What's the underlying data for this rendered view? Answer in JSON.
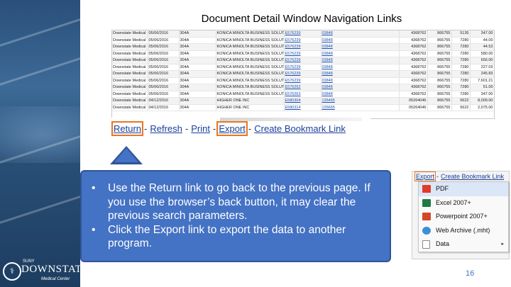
{
  "slide": {
    "title": "Document Detail Window Navigation Links",
    "page_number": "16"
  },
  "logo": {
    "suny": "SUNY",
    "brand": "DOWNSTATE",
    "sub": "Medical Center"
  },
  "table": {
    "rows": [
      [
        "Downstate Medical",
        "05/06/2016",
        "304A",
        "KONICA MINOLTA BUSINESS SOLUTI",
        "E576239",
        "03848",
        "4368762",
        "866755",
        "5135",
        "347.00"
      ],
      [
        "Downstate Medical",
        "05/06/2016",
        "304A",
        "KONICA MINOLTA BUSINESS SOLUTI",
        "E576239",
        "03848",
        "4368762",
        "866755",
        "7280",
        "44.00"
      ],
      [
        "Downstate Medical",
        "05/06/2016",
        "304A",
        "KONICA MINOLTA BUSINESS SOLUTI",
        "E576239",
        "03848",
        "4368762",
        "866755",
        "7280",
        "44.52"
      ],
      [
        "Downstate Medical",
        "05/06/2016",
        "304A",
        "KONICA MINOLTA BUSINESS SOLUTI",
        "E576239",
        "03848",
        "4368762",
        "866755",
        "7280",
        "580.00"
      ],
      [
        "Downstate Medical",
        "05/06/2016",
        "304A",
        "KONICA MINOLTA BUSINESS SOLUTI",
        "E576239",
        "03848",
        "4368762",
        "866755",
        "7280",
        "656.00"
      ],
      [
        "Downstate Medical",
        "05/06/2016",
        "304A",
        "KONICA MINOLTA BUSINESS SOLUTI",
        "E576239",
        "03848",
        "4368762",
        "866755",
        "7280",
        "227.03"
      ],
      [
        "Downstate Medical",
        "05/06/2016",
        "304A",
        "KONICA MINOLTA BUSINESS SOLUTI",
        "E576239",
        "03848",
        "4368762",
        "866755",
        "7280",
        "245.83"
      ],
      [
        "Downstate Medical",
        "05/06/2016",
        "304A",
        "KONICA MINOLTA BUSINESS SOLUTI",
        "E576239",
        "03848",
        "4368762",
        "866755",
        "7280",
        "7,601.21"
      ],
      [
        "Downstate Medical",
        "05/06/2016",
        "304A",
        "KONICA MINOLTA BUSINESS SOLUTI",
        "E576262",
        "03848",
        "4368762",
        "866755",
        "7280",
        "51.00"
      ],
      [
        "Downstate Medical",
        "05/06/2016",
        "304A",
        "KONICA MINOLTA BUSINESS SOLUTI",
        "E576263",
        "03848",
        "4368762",
        "866755",
        "7280",
        "347.00"
      ],
      [
        "Downstate Medical",
        "04/12/2016",
        "304A",
        "HIGHER ONE INC",
        "E580304",
        "135465",
        "05264046",
        "866755",
        "5622",
        "8,009.00"
      ],
      [
        "Downstate Medical",
        "04/12/2016",
        "304A",
        "HIGHER ONE INC",
        "E580314",
        "135665",
        "05264046",
        "866755",
        "5622",
        "2,075.00"
      ]
    ]
  },
  "nav": {
    "return": "Return",
    "refresh": "Refresh",
    "print": "Print",
    "export": "Export",
    "bookmark": "Create Bookmark Link",
    "sep": "-"
  },
  "callout": {
    "bullet": "•",
    "items": [
      "Use the Return link to go back to the previous page. If you use the browser’s back button, it may clear the previous search parameters.",
      "Click the Export link to export the data to another program."
    ]
  },
  "export_menu": {
    "export": "Export",
    "bookmark": "Create Bookmark Link",
    "items": [
      {
        "label": "PDF",
        "icon": "pdf-icon"
      },
      {
        "label": "Excel 2007+",
        "icon": "excel-icon"
      },
      {
        "label": "Powerpoint 2007+",
        "icon": "powerpoint-icon"
      },
      {
        "label": "Web Archive (.mht)",
        "icon": "web-archive-icon"
      },
      {
        "label": "Data",
        "icon": "data-icon"
      }
    ],
    "submenu_arrow": "▸"
  },
  "colors": {
    "accent": "#4472c4",
    "highlight": "#e87722",
    "link": "#1a3f9a"
  }
}
